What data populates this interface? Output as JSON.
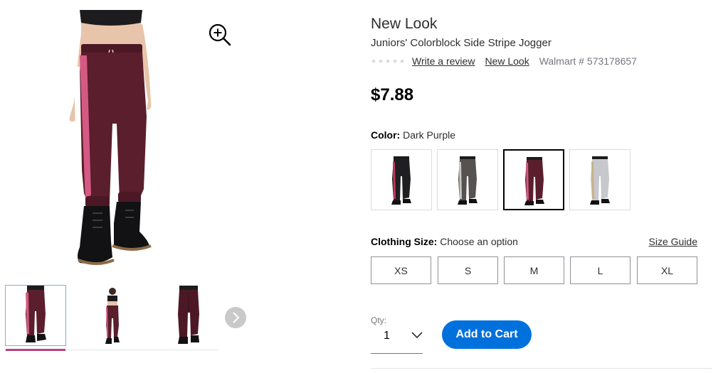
{
  "gallery": {
    "main_image_icon": "model-wearing-jogger-image",
    "zoom_icon": "zoom-in-icon",
    "thumbnails": [
      {
        "icon": "front-view-thumbnail",
        "selected": true
      },
      {
        "icon": "full-body-thumbnail",
        "selected": false
      },
      {
        "icon": "back-view-thumbnail",
        "selected": false
      }
    ],
    "next_icon": "chevron-right-icon"
  },
  "product": {
    "brand": "New Look",
    "title": "Juniors' Colorblock Side Stripe Jogger",
    "write_review": "Write a review",
    "brand_link": "New Look",
    "walmart_number": "Walmart # 573178657",
    "price": "$7.88"
  },
  "color": {
    "label": "Color:",
    "value": "Dark Purple",
    "swatches": [
      {
        "name": "black",
        "pant": "#1f1f22",
        "stripe": "#c0385a"
      },
      {
        "name": "charcoal",
        "pant": "#55524f",
        "stripe": "#c7c7c7"
      },
      {
        "name": "dark-purple",
        "pant": "#5a1e2c",
        "stripe": "#d45a84",
        "selected": true
      },
      {
        "name": "heather-grey",
        "pant": "#c7c8cb",
        "stripe": "#c9b28a"
      }
    ]
  },
  "size": {
    "label": "Clothing Size:",
    "value": "Choose an option",
    "guide": "Size Guide",
    "options": [
      "XS",
      "S",
      "M",
      "L",
      "XL"
    ]
  },
  "qty": {
    "label": "Qty:",
    "value": "1"
  },
  "cart": {
    "label": "Add to Cart"
  },
  "colors": {
    "accent": "#0071dc",
    "pant": "#5a1e2c",
    "stripe_pink": "#d45a84",
    "thumb_active": "#b5457b"
  }
}
